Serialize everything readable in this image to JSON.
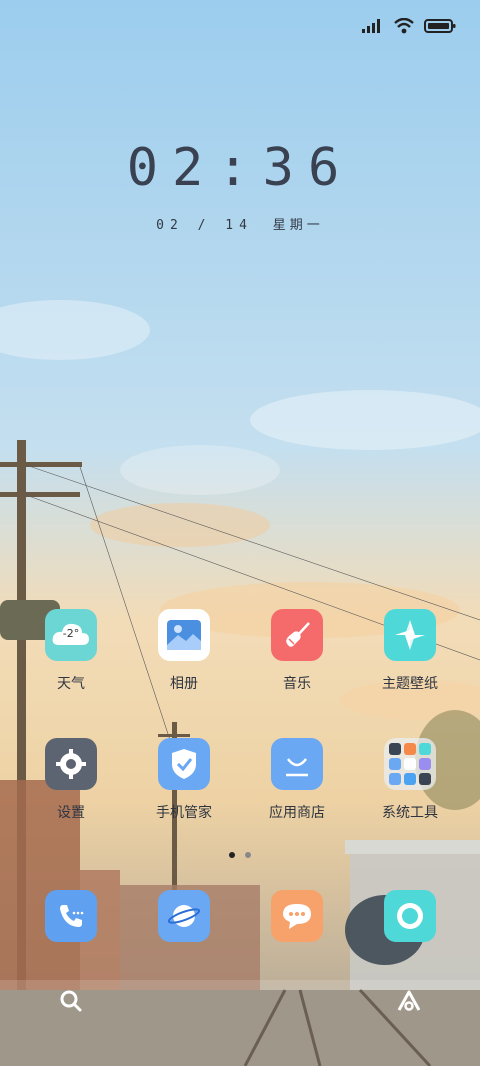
{
  "status": {
    "signal_icon": "signal-icon",
    "wifi_icon": "wifi-icon",
    "battery_icon": "battery-icon"
  },
  "clock": {
    "time": "02:36",
    "date": "02 / 14",
    "weekday": "星期一"
  },
  "apps_row1": [
    {
      "label": "天气",
      "icon": "weather-icon",
      "color": "#6bd6d3",
      "temp": "-2°"
    },
    {
      "label": "相册",
      "icon": "gallery-icon",
      "color": "#ffffff"
    },
    {
      "label": "音乐",
      "icon": "music-icon",
      "color": "#f56b6b"
    },
    {
      "label": "主题壁纸",
      "icon": "theme-icon",
      "color": "#4ed8d8"
    }
  ],
  "apps_row2": [
    {
      "label": "设置",
      "icon": "settings-icon",
      "color": "#5b6470"
    },
    {
      "label": "手机管家",
      "icon": "phone-manager-icon",
      "color": "#6aa8f3"
    },
    {
      "label": "应用商店",
      "icon": "app-store-icon",
      "color": "#6aa8f3"
    },
    {
      "label": "系统工具",
      "icon": "system-tools-folder-icon",
      "color": "#e9edf2"
    }
  ],
  "dock": [
    {
      "name": "phone",
      "icon": "phone-icon",
      "color": "#5fa0f0"
    },
    {
      "name": "browser",
      "icon": "browser-icon",
      "color": "#6aa8f3"
    },
    {
      "name": "messages",
      "icon": "messages-icon",
      "color": "#f7a26a"
    },
    {
      "name": "camera",
      "icon": "camera-icon",
      "color": "#4ed8d8"
    }
  ],
  "page_indicator": {
    "pages": 2,
    "active": 1
  },
  "bottom": {
    "search_icon": "search-icon",
    "assistant_icon": "assistant-icon"
  }
}
